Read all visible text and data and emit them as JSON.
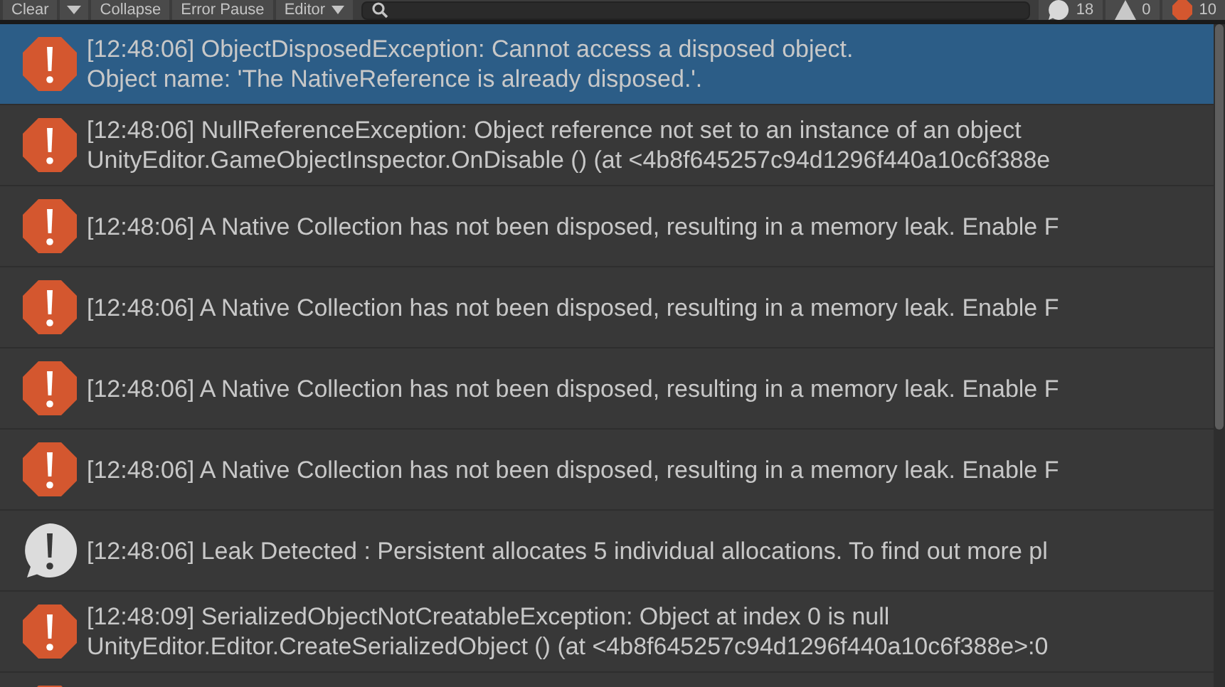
{
  "toolbar": {
    "clear": "Clear",
    "collapse": "Collapse",
    "error_pause": "Error Pause",
    "editor": "Editor",
    "counts": [
      {
        "kind": "info",
        "count": "18"
      },
      {
        "kind": "warning",
        "count": "0"
      },
      {
        "kind": "error",
        "count": "10"
      }
    ]
  },
  "entries": [
    {
      "kind": "error",
      "selected": true,
      "lines": [
        "[12:48:06] ObjectDisposedException: Cannot access a disposed object.",
        "Object name: 'The NativeReference is already disposed.'."
      ]
    },
    {
      "kind": "error",
      "selected": false,
      "lines": [
        "[12:48:06] NullReferenceException: Object reference not set to an instance of an object",
        "UnityEditor.GameObjectInspector.OnDisable () (at <4b8f645257c94d1296f440a10c6f388e"
      ]
    },
    {
      "kind": "error",
      "selected": false,
      "lines": [
        "[12:48:06] A Native Collection has not been disposed, resulting in a memory leak. Enable F"
      ]
    },
    {
      "kind": "error",
      "selected": false,
      "lines": [
        "[12:48:06] A Native Collection has not been disposed, resulting in a memory leak. Enable F"
      ]
    },
    {
      "kind": "error",
      "selected": false,
      "lines": [
        "[12:48:06] A Native Collection has not been disposed, resulting in a memory leak. Enable F"
      ]
    },
    {
      "kind": "error",
      "selected": false,
      "lines": [
        "[12:48:06] A Native Collection has not been disposed, resulting in a memory leak. Enable F"
      ]
    },
    {
      "kind": "info",
      "selected": false,
      "lines": [
        "[12:48:06] Leak Detected : Persistent allocates 5 individual allocations. To find out more pl"
      ]
    },
    {
      "kind": "error",
      "selected": false,
      "lines": [
        "[12:48:09] SerializedObjectNotCreatableException: Object at index 0 is null",
        "UnityEditor.Editor.CreateSerializedObject () (at <4b8f645257c94d1296f440a10c6f388e>:0"
      ]
    },
    {
      "kind": "error",
      "selected": false
    }
  ]
}
